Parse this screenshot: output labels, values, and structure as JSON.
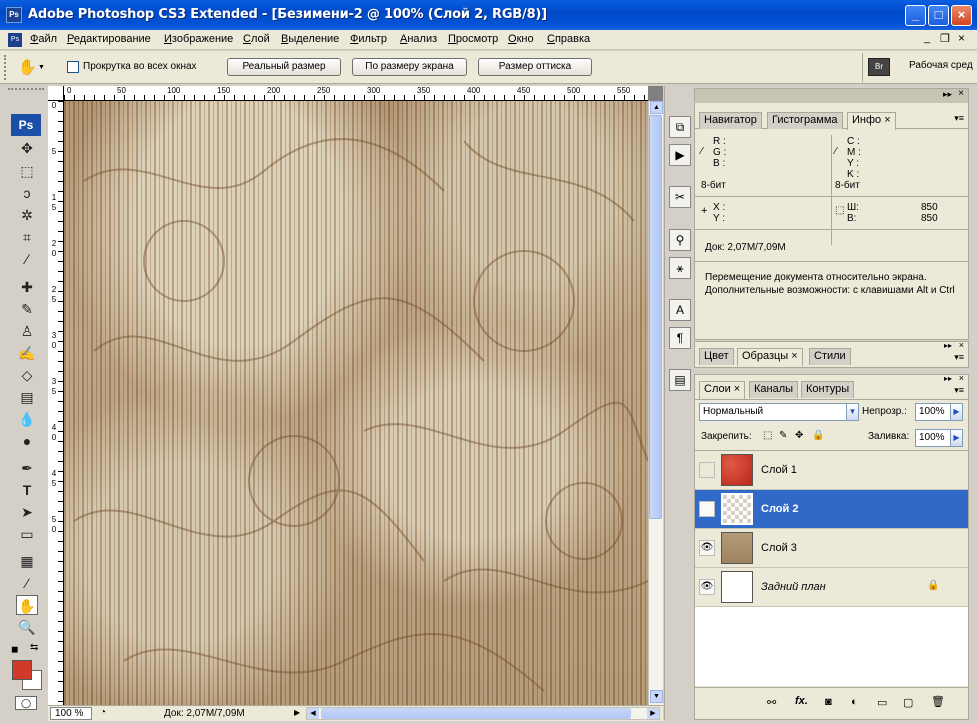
{
  "window": {
    "title": "Adobe Photoshop CS3 Extended - [Безимени-2 @ 100% (Слой 2, RGB/8)]",
    "app_icon": "Ps"
  },
  "menu": [
    "Файл",
    "Редактирование",
    "Изображение",
    "Слой",
    "Выделение",
    "Фильтр",
    "Анализ",
    "Просмотр",
    "Окно",
    "Справка"
  ],
  "options": {
    "scroll_all_label": "Прокрутка во всех окнах",
    "actual_pixels": "Реальный размер",
    "fit_screen": "По размеру экрана",
    "print_size": "Размер оттиска",
    "workspace": "Рабочая сред"
  },
  "toolbox": {
    "logo": "Ps"
  },
  "ruler": {
    "h_ticks": [
      "0",
      "50",
      "100",
      "150",
      "200",
      "250",
      "300",
      "350",
      "400",
      "450",
      "500",
      "550"
    ],
    "v_ticks": [
      "0",
      "5",
      "1",
      "5",
      "2",
      "0",
      "2",
      "5",
      "3",
      "0",
      "3",
      "5",
      "4",
      "0",
      "4",
      "5",
      "5",
      "0"
    ]
  },
  "status": {
    "zoom": "100 %",
    "doc": "Док: 2,07M/7,09M"
  },
  "info_panel": {
    "tabs": [
      "Навигатор",
      "Гистограмма",
      "Инфо"
    ],
    "r": "R :",
    "g": "G :",
    "b": "B :",
    "c": "C :",
    "m": "M :",
    "y": "Y :",
    "k": "K :",
    "bit_left": "8-бит",
    "bit_right": "8-бит",
    "x": "X :",
    "yy": "Y :",
    "w": "Ш:",
    "h": "В:",
    "w_val": "850",
    "h_val": "850",
    "doc": "Док: 2,07M/7,09M",
    "hint": "Перемещение документа относительно экрана. Дополнительные возможности: с клавишами Alt и Ctrl"
  },
  "swatch_panel": {
    "tabs": [
      "Цвет",
      "Образцы",
      "Стили"
    ]
  },
  "layers_panel": {
    "tabs": [
      "Слои",
      "Каналы",
      "Контуры"
    ],
    "blend_mode": "Нормальный",
    "opacity_label": "Непрозр.:",
    "opacity": "100%",
    "lock_label": "Закрепить:",
    "fill_label": "Заливка:",
    "fill": "100%",
    "layers": [
      {
        "name": "Слой 1",
        "visible": false,
        "selected": false
      },
      {
        "name": "Слой 2",
        "visible": true,
        "selected": true
      },
      {
        "name": "Слой 3",
        "visible": true,
        "selected": false
      },
      {
        "name": "Задний план",
        "visible": true,
        "selected": false
      }
    ]
  },
  "colors": {
    "foreground": "#d03a2a",
    "background": "#ffffff",
    "selection": "#3169c6"
  }
}
